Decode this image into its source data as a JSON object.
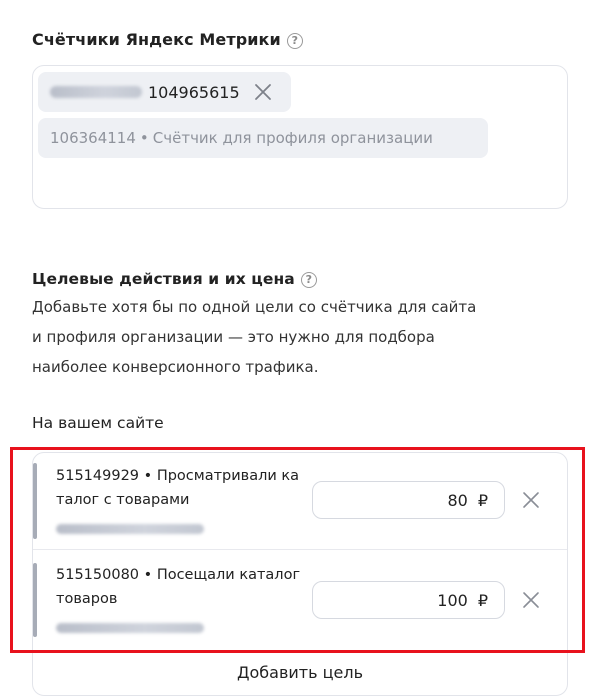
{
  "metrika": {
    "title": "Счётчики Яндекс Метрики",
    "help_icon": "?",
    "counters": [
      {
        "id": "104965615",
        "selected": true
      },
      {
        "id": "106364114",
        "description": "Счётчик для профиля организации",
        "selected": false
      }
    ],
    "separator": "•"
  },
  "goals": {
    "title": "Целевые действия и их цена",
    "help_icon": "?",
    "description_lines": [
      "Добавьте хотя бы по одной цели со счётчика для сайта",
      "и профиля организации — это нужно для подбора",
      "наиболее конверсионного трафика."
    ],
    "site_label": "На вашем сайте",
    "items": [
      {
        "id": "515149929",
        "name_line1": "Просматривали ка",
        "name_line2": "талог с товарами",
        "price": "80",
        "currency": "₽"
      },
      {
        "id": "515150080",
        "name_line1": "Посещали каталог",
        "name_line2": "товаров",
        "price": "100",
        "currency": "₽"
      }
    ],
    "add_label": "Добавить цель"
  },
  "colors": {
    "highlight": "#e8121d",
    "chip_bg": "#eef0f4",
    "border": "#e2e4ea"
  }
}
